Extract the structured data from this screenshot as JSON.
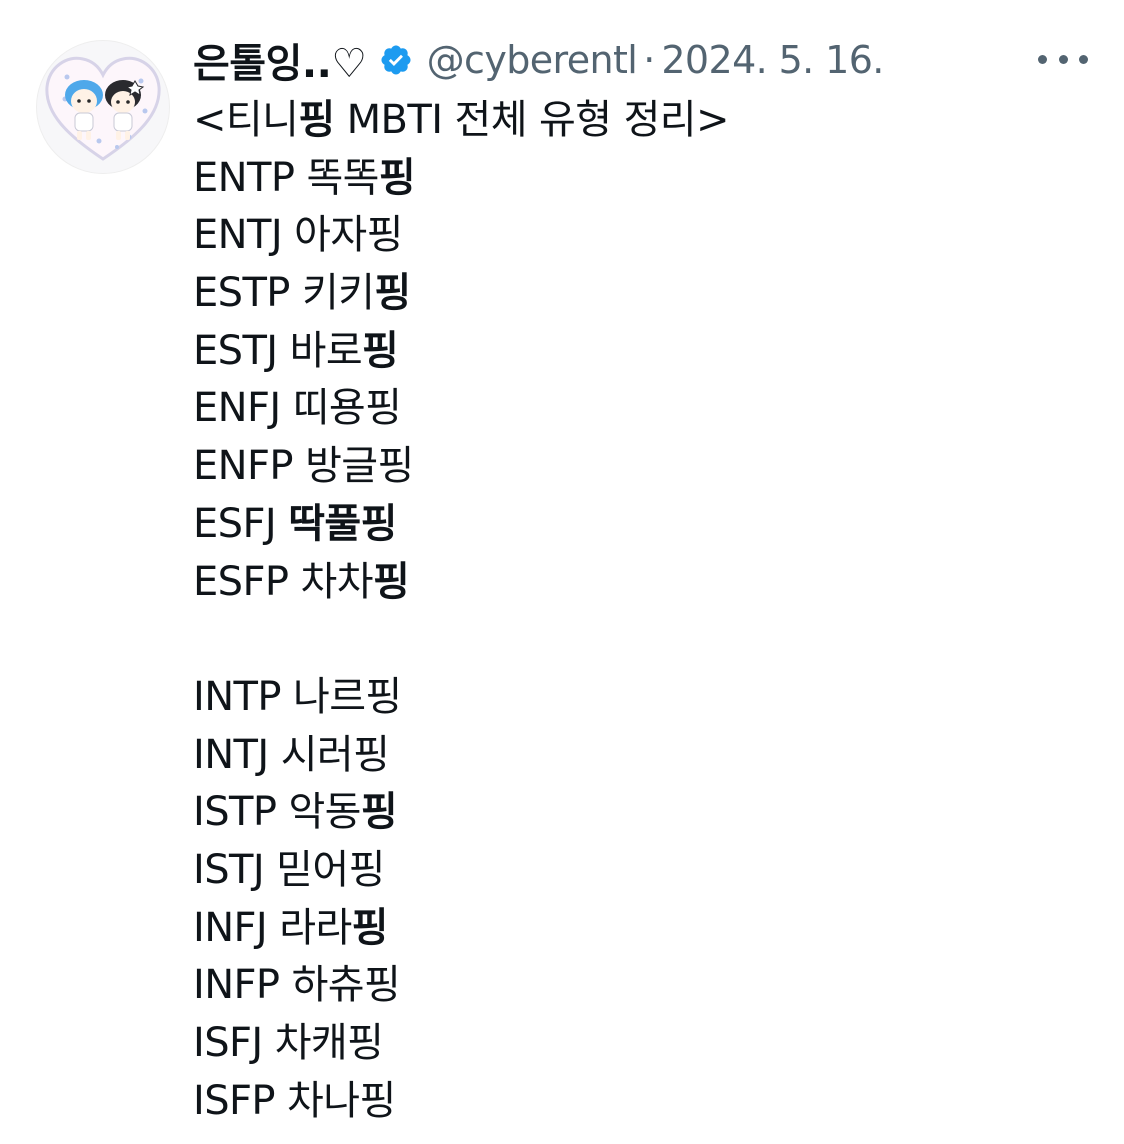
{
  "user": {
    "display_name": "은톨잉..♡",
    "handle": "@cyberentl",
    "separator": "·",
    "date": "2024. 5. 16.",
    "verified_color": "#1d9bf0"
  },
  "icons": {
    "verified": "verified-badge-icon",
    "more": "more-options-icon"
  },
  "tweet": {
    "title": {
      "pre": "<티니",
      "bold": "핑",
      "post": " MBTI 전체 유형 정리>"
    },
    "group1": [
      {
        "type": "ENTP",
        "name": "똑똑",
        "suffix": "핑",
        "bold": true
      },
      {
        "type": "ENTJ",
        "name": "아자",
        "suffix": "핑",
        "bold": false
      },
      {
        "type": "ESTP",
        "name": "키키",
        "suffix": "핑",
        "bold": true
      },
      {
        "type": "ESTJ",
        "name": "바로",
        "suffix": "핑",
        "bold": true
      },
      {
        "type": "ENFJ",
        "name": "띠용",
        "suffix": "핑",
        "bold": false
      },
      {
        "type": "ENFP",
        "name": "방글",
        "suffix": "핑",
        "bold": false
      },
      {
        "type": "ESFJ",
        "name": "딱풀",
        "suffix": "핑",
        "bold": true,
        "name_bold": true
      },
      {
        "type": "ESFP",
        "name": "차차",
        "suffix": "핑",
        "bold": true
      }
    ],
    "group2": [
      {
        "type": "INTP",
        "name": "나르",
        "suffix": "핑",
        "bold": false
      },
      {
        "type": "INTJ",
        "name": "시러",
        "suffix": "핑",
        "bold": false
      },
      {
        "type": "ISTP",
        "name": "악동",
        "suffix": "핑",
        "bold": true
      },
      {
        "type": "ISTJ",
        "name": "믿어",
        "suffix": "핑",
        "bold": false
      },
      {
        "type": "INFJ",
        "name": "라라",
        "suffix": "핑",
        "bold": true
      },
      {
        "type": "INFP",
        "name": "하츄",
        "suffix": "핑",
        "bold": false
      },
      {
        "type": "ISFJ",
        "name": "차캐",
        "suffix": "핑",
        "bold": false
      },
      {
        "type": "ISFP",
        "name": "차나",
        "suffix": "핑",
        "bold": false
      }
    ]
  }
}
